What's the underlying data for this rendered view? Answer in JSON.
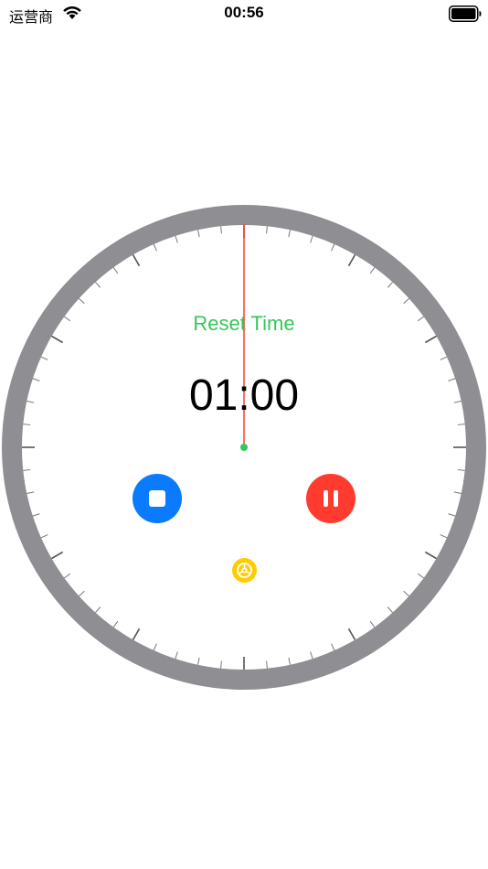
{
  "status_bar": {
    "carrier": "运营商",
    "time": "00:56"
  },
  "timer": {
    "reset_label": "Reset Time",
    "display": "01:00"
  },
  "icons": {
    "wifi": "wifi-icon",
    "battery": "battery-icon",
    "stop": "stop-icon",
    "pause": "pause-icon",
    "settings": "gear-icon"
  },
  "colors": {
    "dial_ring": "#8e8e93",
    "hand": "#ff3b30",
    "center_dot": "#34c759",
    "reset_label": "#34c759",
    "stop_button": "#0a7bff",
    "pause_button": "#ff3b30",
    "settings_button": "#ffcc00"
  }
}
